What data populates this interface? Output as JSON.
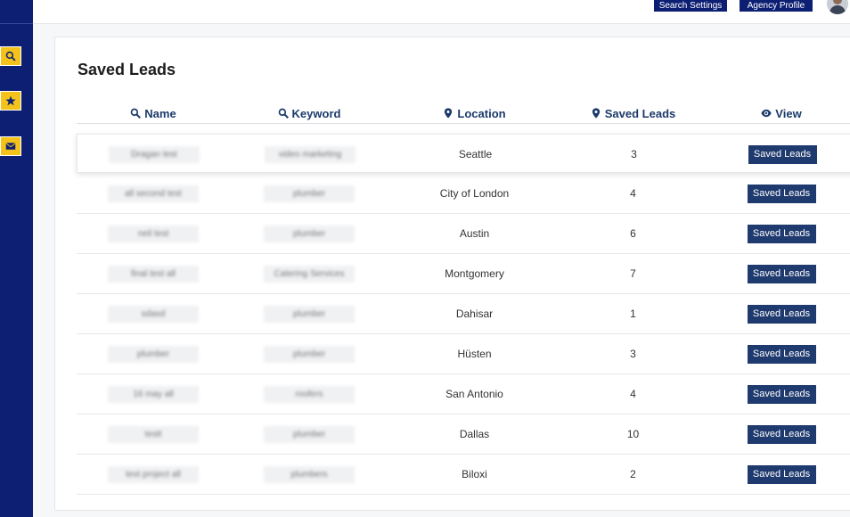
{
  "sidebar": {
    "buttons": [
      {
        "icon": "search-icon"
      },
      {
        "icon": "star-icon"
      },
      {
        "icon": "envelope-icon"
      }
    ]
  },
  "topbar": {
    "search_settings": "Search Settings",
    "agency_profile": "Agency Profile"
  },
  "page": {
    "title": "Saved Leads"
  },
  "table": {
    "headers": {
      "name": "Name",
      "keyword": "Keyword",
      "location": "Location",
      "saved_leads": "Saved Leads",
      "view": "View"
    },
    "button_label": "Saved Leads",
    "rows": [
      {
        "name": "Dragan test",
        "keyword": "video marketing",
        "location": "Seattle",
        "count": "3"
      },
      {
        "name": "all second test",
        "keyword": "plumber",
        "location": "City of London",
        "count": "4"
      },
      {
        "name": "neil test",
        "keyword": "plumber",
        "location": "Austin",
        "count": "6"
      },
      {
        "name": "final test all",
        "keyword": "Catering Services",
        "location": "Montgomery",
        "count": "7"
      },
      {
        "name": "sdasd",
        "keyword": "plumber",
        "location": "Dahisar",
        "count": "1"
      },
      {
        "name": "plumber",
        "keyword": "plumber",
        "location": "Hüsten",
        "count": "3"
      },
      {
        "name": "16 may all",
        "keyword": "roofers",
        "location": "San Antonio",
        "count": "4"
      },
      {
        "name": "testt",
        "keyword": "plumber",
        "location": "Dallas",
        "count": "10"
      },
      {
        "name": "test project all",
        "keyword": "plumbers",
        "location": "Biloxi",
        "count": "2"
      }
    ]
  },
  "colors": {
    "sidebar": "#0d1f73",
    "accent_yellow": "#f3c21b",
    "header_text": "#1b3a6b",
    "button": "#1f3a6e"
  }
}
